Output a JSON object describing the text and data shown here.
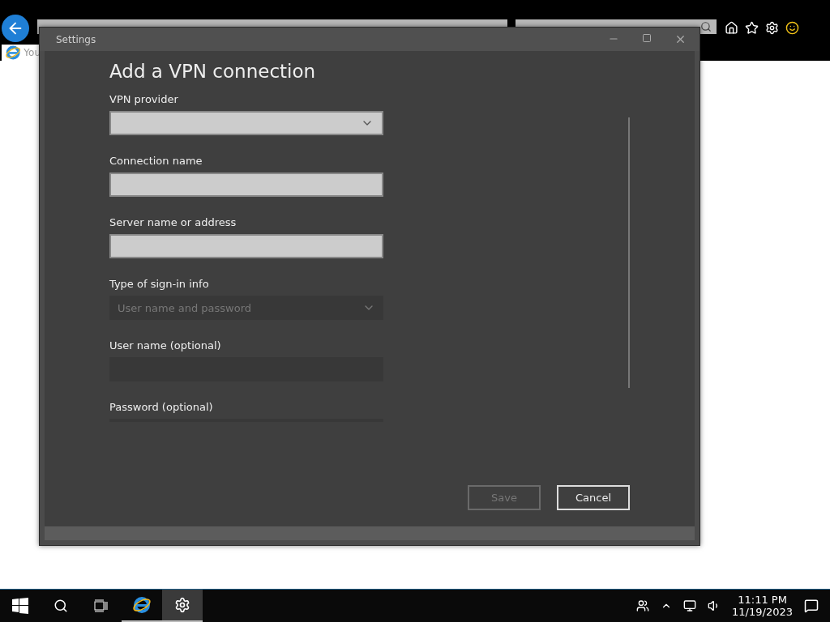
{
  "browser": {
    "tab_title": "You"
  },
  "window": {
    "title": "Settings",
    "heading": "Add a VPN connection",
    "fields": [
      {
        "label": "VPN provider",
        "kind": "dropdown",
        "disabled": false
      },
      {
        "label": "Connection name",
        "kind": "text",
        "disabled": false
      },
      {
        "label": "Server name or address",
        "kind": "text",
        "disabled": false
      },
      {
        "label": "Type of sign-in info",
        "kind": "dropdown",
        "disabled": true,
        "value": "User name and password"
      },
      {
        "label": "User name (optional)",
        "kind": "text",
        "disabled": true
      },
      {
        "label": "Password (optional)",
        "kind": "text",
        "disabled": true
      }
    ],
    "buttons": [
      {
        "label": "Save",
        "disabled": true
      },
      {
        "label": "Cancel",
        "disabled": false
      }
    ]
  },
  "taskbar": {
    "apps": [
      {
        "kind": "ie",
        "selected": false
      },
      {
        "kind": "settings",
        "selected": true
      }
    ],
    "time": "11:11 PM",
    "date": "11/19/2023"
  }
}
